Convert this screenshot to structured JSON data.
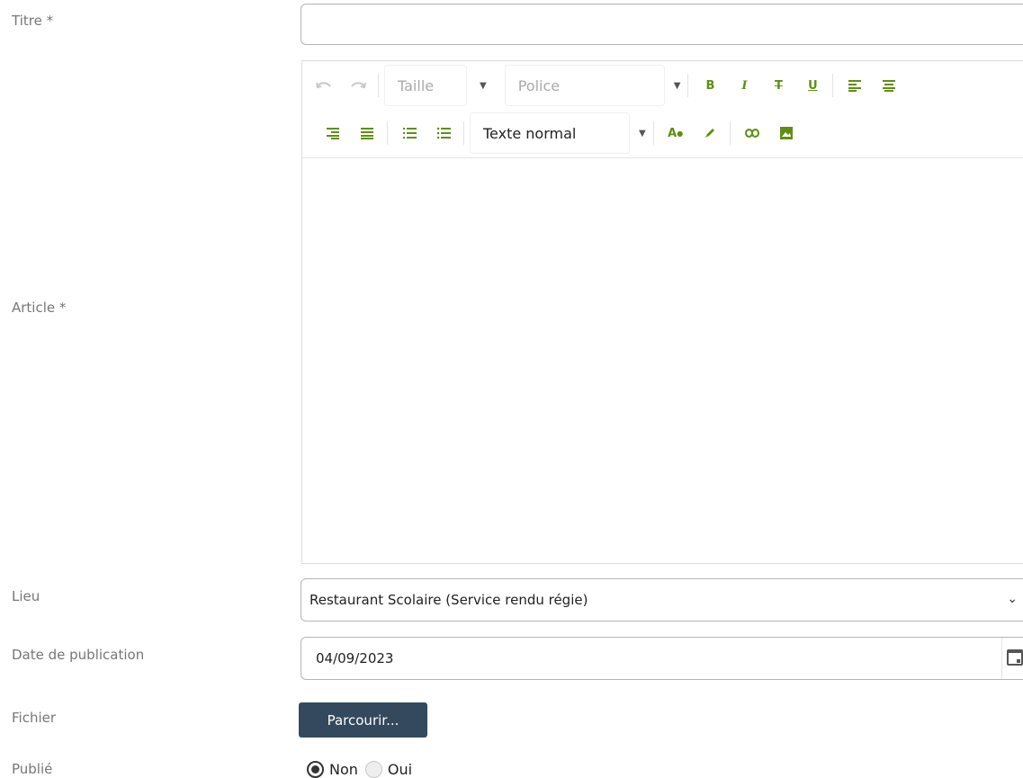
{
  "form": {
    "titre_label": "Titre *",
    "titre_value": "",
    "article_label": "Article *",
    "lieu_label": "Lieu",
    "lieu_value": "Restaurant Scolaire (Service rendu régie)",
    "date_label": "Date de publication",
    "date_value": "04/09/2023",
    "fichier_label": "Fichier",
    "parcourir_label": "Parcourir...",
    "publie_label": "Publié",
    "publie_options": [
      "Non",
      "Oui"
    ],
    "publie_selected": "Non"
  },
  "toolbar": {
    "size_placeholder": "Taille",
    "font_placeholder": "Police",
    "style_value": "Texte normal",
    "bold": "B",
    "italic": "I",
    "strike": "T",
    "underline": "U",
    "font_color": "A",
    "accent_color": "#5f8f12",
    "icons": [
      "undo-icon",
      "redo-icon",
      "bold-icon",
      "italic-icon",
      "strikethrough-icon",
      "underline-icon",
      "align-left-icon",
      "align-center-icon",
      "align-right-icon",
      "align-justify-icon",
      "ordered-list-icon",
      "bullet-list-icon",
      "font-color-icon",
      "highlighter-icon",
      "link-icon",
      "image-icon"
    ]
  }
}
